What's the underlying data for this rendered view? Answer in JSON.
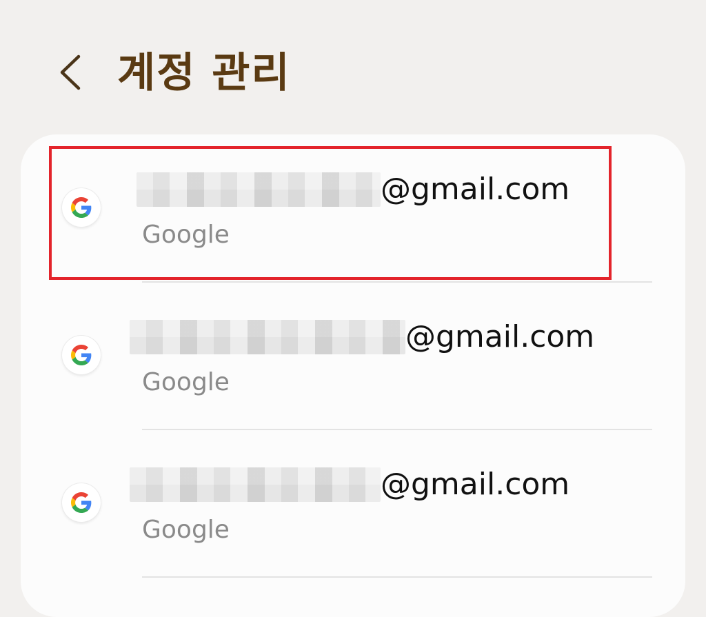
{
  "header": {
    "title": "계정 관리",
    "back_icon": "chevron-left-icon"
  },
  "accounts": [
    {
      "email_domain": "@gmail.com",
      "provider": "Google",
      "icon": "google-g-icon",
      "email_local_redacted": true,
      "highlighted": true
    },
    {
      "email_domain": "@gmail.com",
      "provider": "Google",
      "icon": "google-g-icon",
      "email_local_redacted": true,
      "highlighted": false
    },
    {
      "email_domain": "@gmail.com",
      "provider": "Google",
      "icon": "google-g-icon",
      "email_local_redacted": true,
      "highlighted": false
    }
  ],
  "colors": {
    "background": "#f2f0ee",
    "card": "#fcfcfc",
    "title": "#5a3a12",
    "highlight": "#e3242b",
    "secondary_text": "#8a8a8a",
    "google_blue": "#4285F4",
    "google_green": "#34A853",
    "google_yellow": "#FBBC05",
    "google_red": "#EA4335"
  }
}
